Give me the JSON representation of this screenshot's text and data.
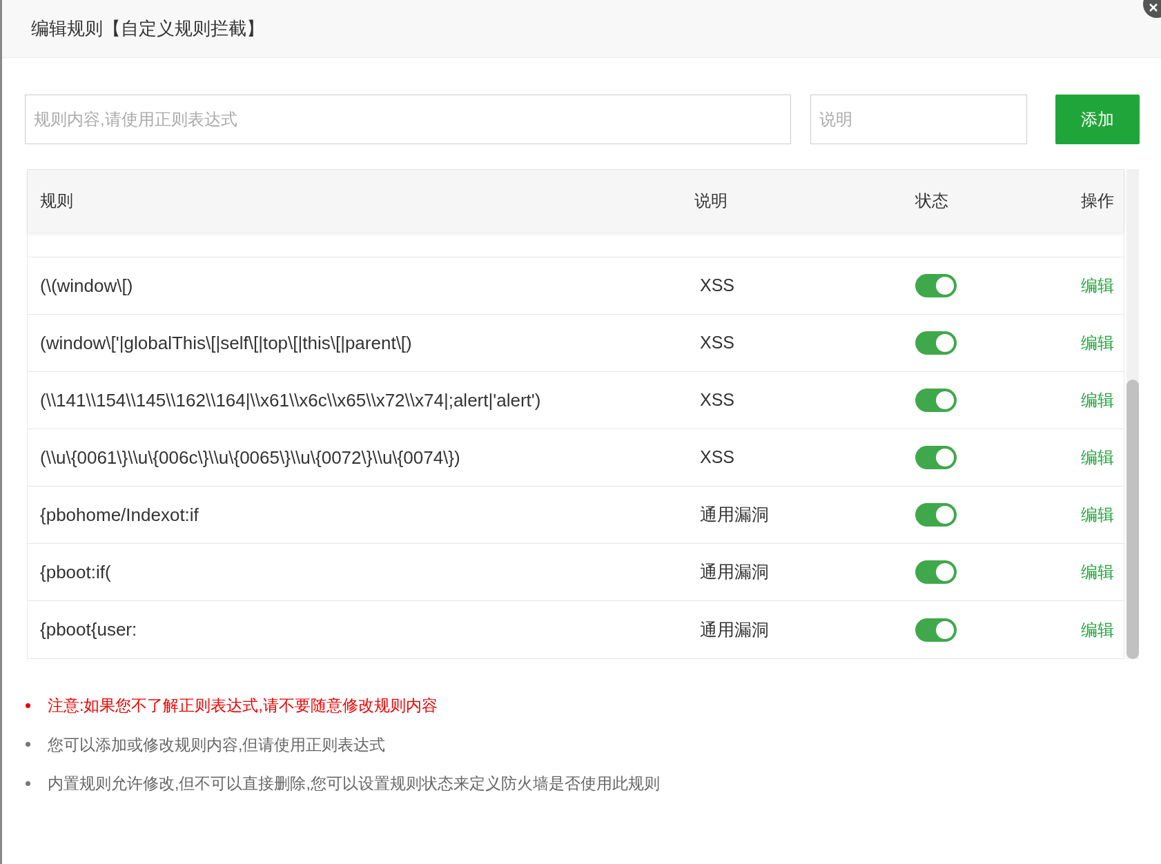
{
  "dialog": {
    "title": "编辑规则【自定义规则拦截】"
  },
  "form": {
    "rule_placeholder": "规则内容,请使用正则表达式",
    "note_placeholder": "说明",
    "add_button": "添加"
  },
  "table": {
    "columns": [
      "规则",
      "说明",
      "状态",
      "操作"
    ],
    "rows": [
      {
        "rule": "(\\(window\\[)",
        "note": "XSS",
        "on": true,
        "action": "编辑"
      },
      {
        "rule": "(window\\['|globalThis\\[|self\\[|top\\[|this\\[|parent\\[)",
        "note": "XSS",
        "on": true,
        "action": "编辑"
      },
      {
        "rule": "(\\\\141\\\\154\\\\145\\\\162\\\\164|\\\\x61\\\\x6c\\\\x65\\\\x72\\\\x74|;alert|'alert')",
        "note": "XSS",
        "on": true,
        "action": "编辑"
      },
      {
        "rule": "(\\\\u\\{0061\\}\\\\u\\{006c\\}\\\\u\\{0065\\}\\\\u\\{0072\\}\\\\u\\{0074\\})",
        "note": "XSS",
        "on": true,
        "action": "编辑"
      },
      {
        "rule": "{pbohome/Indexot:if",
        "note": "通用漏洞",
        "on": true,
        "action": "编辑"
      },
      {
        "rule": "{pboot:if(",
        "note": "通用漏洞",
        "on": true,
        "action": "编辑"
      },
      {
        "rule": "{pboot{user:",
        "note": "通用漏洞",
        "on": true,
        "action": "编辑"
      }
    ]
  },
  "notes": [
    {
      "text": "注意:如果您不了解正则表达式,请不要随意修改规则内容",
      "kind": "warning"
    },
    {
      "text": "您可以添加或修改规则内容,但请使用正则表达式",
      "kind": "info"
    },
    {
      "text": "内置规则允许修改,但不可以直接删除,您可以设置规则状态来定义防火墙是否使用此规则",
      "kind": "info"
    }
  ]
}
